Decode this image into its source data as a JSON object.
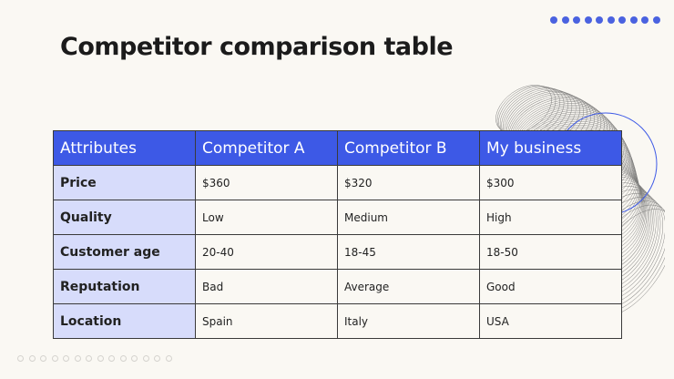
{
  "slide": {
    "title": "Competitor comparison table"
  },
  "colors": {
    "background": "#faf8f3",
    "header_fill": "#3d59e6",
    "attribute_fill": "#d7dcfb",
    "dot_accent": "#4a62e0"
  },
  "decoration": {
    "top_dots_count": 10,
    "bottom_dots_count": 14,
    "shape": "wireframe-swirl"
  },
  "table": {
    "headers": [
      "Attributes",
      "Competitor A",
      "Competitor B",
      "My business"
    ],
    "rows": [
      [
        "Price",
        "$360",
        "$320",
        "$300"
      ],
      [
        "Quality",
        "Low",
        "Medium",
        "High"
      ],
      [
        "Customer age",
        "20-40",
        "18-45",
        "18-50"
      ],
      [
        "Reputation",
        "Bad",
        "Average",
        "Good"
      ],
      [
        "Location",
        "Spain",
        "Italy",
        "USA"
      ]
    ]
  }
}
